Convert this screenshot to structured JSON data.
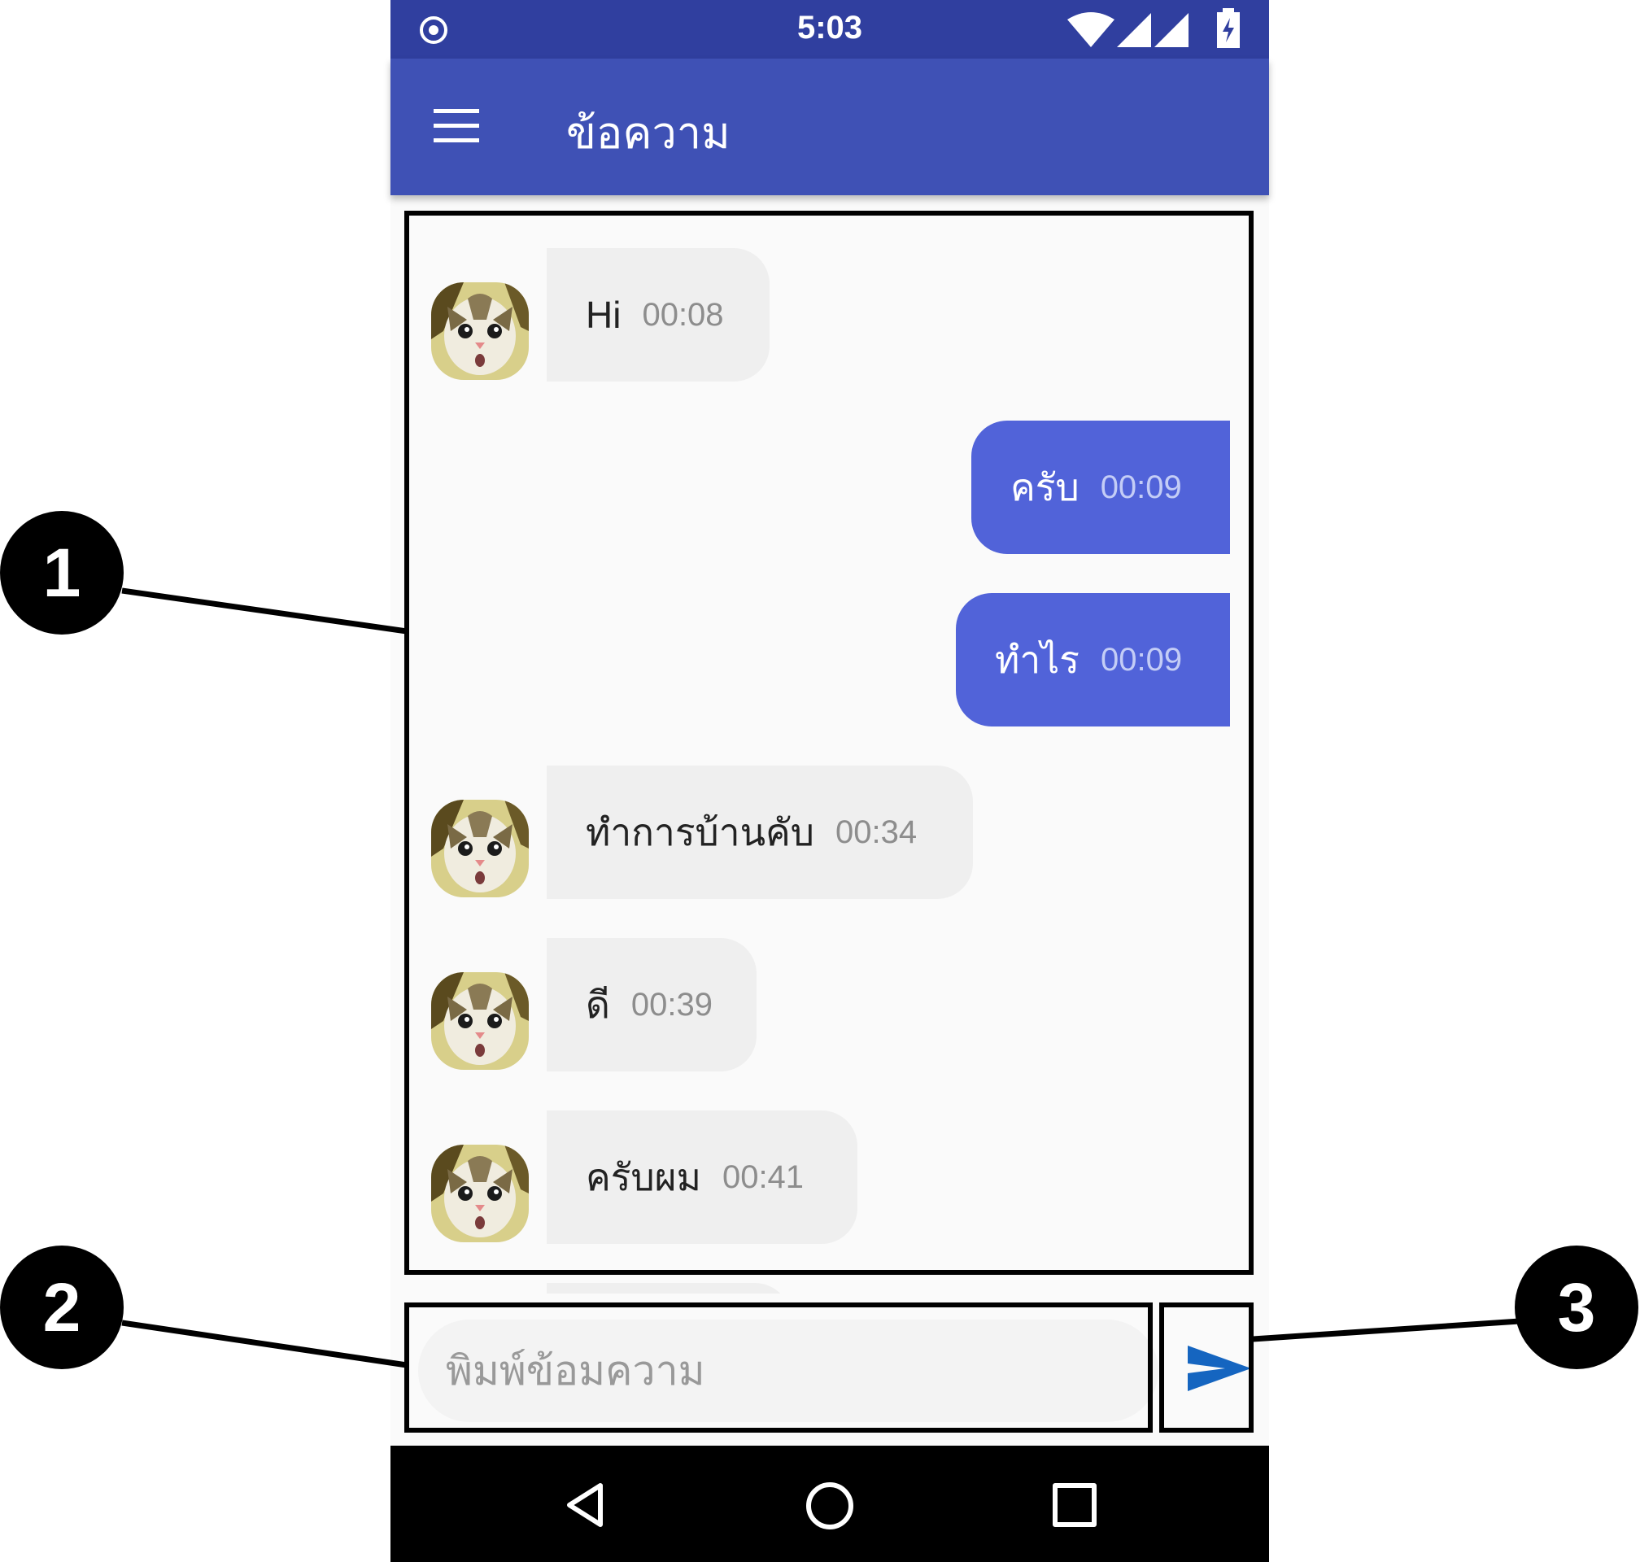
{
  "status_bar": {
    "time": "5:03"
  },
  "app_bar": {
    "title": "ข้อความ"
  },
  "messages": [
    {
      "direction": "in",
      "text": "Hi",
      "time": "00:08"
    },
    {
      "direction": "out",
      "text": "ครับ",
      "time": "00:09"
    },
    {
      "direction": "out",
      "text": "ทำไร",
      "time": "00:09"
    },
    {
      "direction": "in",
      "text": "ทำการบ้านคับ",
      "time": "00:34"
    },
    {
      "direction": "in",
      "text": "ดี",
      "time": "00:39"
    },
    {
      "direction": "in",
      "text": "ครับผม",
      "time": "00:41"
    }
  ],
  "composer": {
    "placeholder": "พิมพ์ข้อมความ"
  },
  "callouts": [
    "1",
    "2",
    "3"
  ],
  "colors": {
    "status_bar": "#303f9f",
    "app_bar": "#3f51b5",
    "outgoing_bubble": "#5163d9",
    "incoming_bubble": "#efefef",
    "send_icon": "#1565c0"
  },
  "icons": [
    "radio-indicator-icon",
    "wifi-icon",
    "signal-icon",
    "battery-icon",
    "menu-icon",
    "send-icon",
    "nav-back-icon",
    "nav-home-icon",
    "nav-recents-icon"
  ]
}
